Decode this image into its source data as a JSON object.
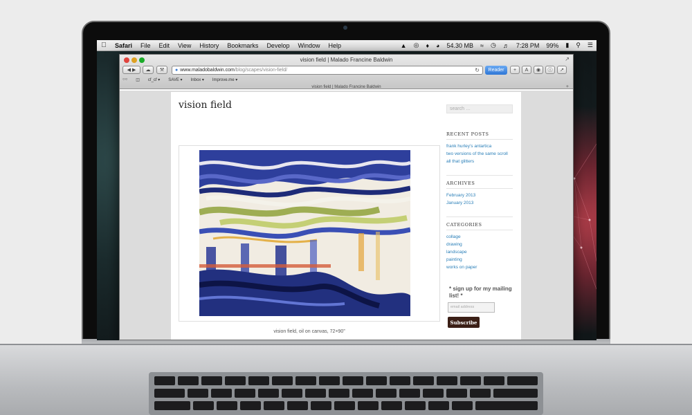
{
  "menubar": {
    "apple": "",
    "items": [
      "Safari",
      "File",
      "Edit",
      "View",
      "History",
      "Bookmarks",
      "Develop",
      "Window",
      "Help"
    ],
    "status": {
      "memory": "54.30 MB",
      "clock": "7:28 PM",
      "battery": "99%"
    }
  },
  "browser": {
    "window_title": "vision field | Malado Francine Baldwin",
    "url_host": "www.maladobaldwin.com",
    "url_path": "/blog/scapes/vision-field/",
    "reader_label": "Reader",
    "bookmarks": [
      "cf_cf ▾",
      "SAVE ▾",
      "Inbox ▾",
      "Improve.me ▾"
    ],
    "tab_title": "vision field | Malado Francine Baldwin"
  },
  "post": {
    "title": "vision field",
    "caption": "vision field, oil on canvas, 72×90”"
  },
  "sidebar": {
    "search_placeholder": "search …",
    "recent_title": "RECENT POSTS",
    "recent_posts": [
      "frank hurley’s antartica",
      "two versions of the same scroll",
      "all that glitters"
    ],
    "archives_title": "ARCHIVES",
    "archives": [
      "February 2013",
      "January 2013"
    ],
    "categories_title": "CATEGORIES",
    "categories": [
      "collage",
      "drawing",
      "landscape",
      "painting",
      "works on paper"
    ],
    "mailing_title": "* sign up for my mailing list! *",
    "email_placeholder": "email address",
    "subscribe_label": "Subscribe"
  }
}
